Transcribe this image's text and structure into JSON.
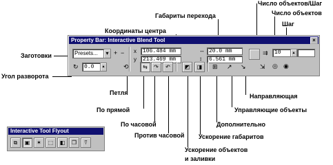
{
  "window": {
    "title": "Property Bar: Interactive Blend Tool",
    "close_glyph": "×",
    "presets_value": "Presets...",
    "pos_x": "106.484 mm",
    "pos_y": "213.469 mm",
    "size_w": "20.0 mm",
    "size_h": "6.561 mm",
    "steps_value": "10",
    "angle_value": "0.0"
  },
  "tool_window": {
    "title": "Interactive Tool Flyout"
  },
  "labels": {
    "objects_steps": "Число объектов/Шаг",
    "objects_count": "Число объектов",
    "step": "Шаг",
    "transition_size": "Габариты перехода",
    "center_coords": "Координаты центра",
    "presets": "Заготовки",
    "rotation_angle": "Угол разворота",
    "loop": "Петля",
    "direct": "По прямой",
    "clockwise": "По часовой",
    "counterclockwise": "Против часовой",
    "object_fill_accel_1": "Ускорение объектов",
    "object_fill_accel_2": "и заливки",
    "size_accel": "Ускорение габаритов",
    "additional": "Дополнительно",
    "control_objects": "Управляющие объекты",
    "path": "Направляющая"
  }
}
